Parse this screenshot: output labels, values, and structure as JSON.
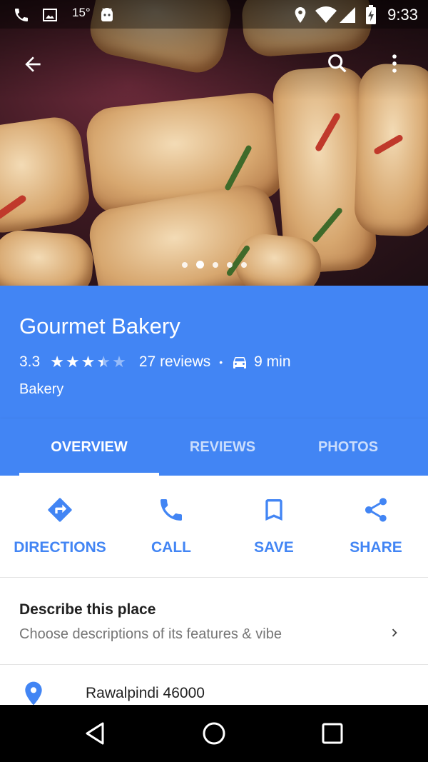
{
  "status_bar": {
    "temperature": "15°",
    "time": "9:33"
  },
  "toolbar": {
    "back_icon": "arrow-back-icon",
    "search_icon": "search-icon",
    "more_icon": "more-vert-icon"
  },
  "photo_carousel": {
    "page_count": 5,
    "active_index": 1
  },
  "place": {
    "name": "Gourmet Bakery",
    "rating": "3.3",
    "rating_value": 3.3,
    "reviews": "27 reviews",
    "separator": "•",
    "drive_time": "9 min",
    "category": "Bakery"
  },
  "tabs": [
    {
      "label": "OVERVIEW",
      "active": true
    },
    {
      "label": "REVIEWS",
      "active": false
    },
    {
      "label": "PHOTOS",
      "active": false
    }
  ],
  "actions": [
    {
      "label": "DIRECTIONS",
      "icon": "directions-icon"
    },
    {
      "label": "CALL",
      "icon": "phone-icon"
    },
    {
      "label": "SAVE",
      "icon": "bookmark-icon"
    },
    {
      "label": "SHARE",
      "icon": "share-icon"
    }
  ],
  "describe": {
    "heading": "Describe this place",
    "subtext": "Choose descriptions of its features & vibe"
  },
  "address": {
    "text": "Rawalpindi 46000"
  },
  "colors": {
    "primary": "#4285f4",
    "text_dark": "#212121",
    "text_secondary": "#757575"
  }
}
